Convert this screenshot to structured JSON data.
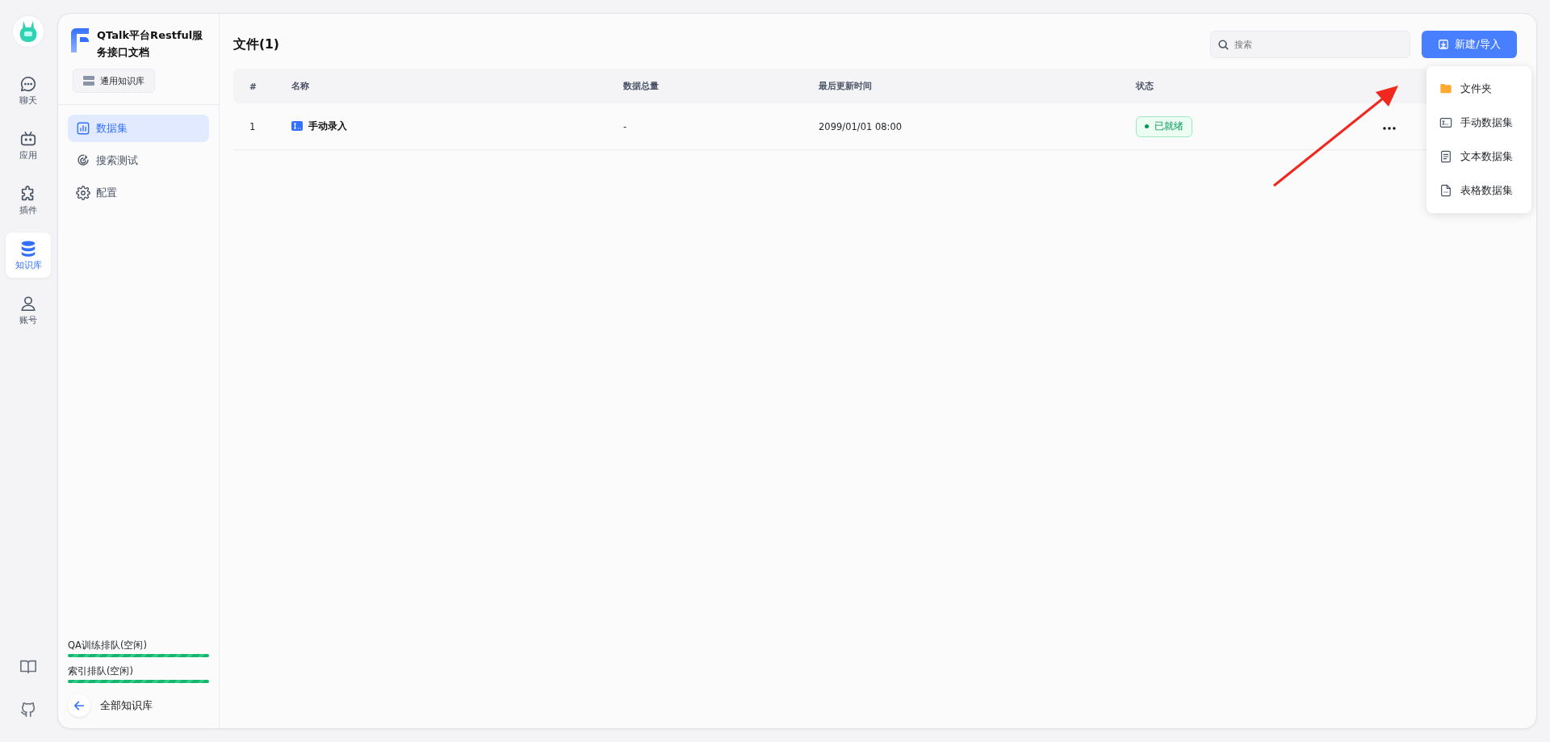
{
  "nav": {
    "items": [
      {
        "label": "聊天",
        "selected": false
      },
      {
        "label": "应用",
        "selected": false
      },
      {
        "label": "插件",
        "selected": false
      },
      {
        "label": "知识库",
        "selected": true
      },
      {
        "label": "账号",
        "selected": false
      }
    ]
  },
  "sidebar": {
    "title": "QTalk平台Restful服务接口文档",
    "type_button": "通用知识库",
    "menu": [
      {
        "label": "数据集",
        "selected": true
      },
      {
        "label": "搜索测试",
        "selected": false
      },
      {
        "label": "配置",
        "selected": false
      }
    ],
    "queues": [
      {
        "label": "QA训练排队(空闲)",
        "level": 1
      },
      {
        "label": "索引排队(空闲)",
        "level": 1
      }
    ],
    "back": "全部知识库"
  },
  "content": {
    "title": "文件(1)",
    "search": {
      "placeholder": "搜索"
    },
    "new_button": "新建/导入",
    "table": {
      "columns": [
        "#",
        "名称",
        "数据总量",
        "最后更新时间",
        "状态"
      ],
      "rows": [
        {
          "index": "1",
          "name": "手动录入",
          "count": "-",
          "updated": "2099/01/01 08:00",
          "status": "已就绪"
        }
      ]
    },
    "menu": [
      "文件夹",
      "手动数据集",
      "文本数据集",
      "表格数据集"
    ]
  }
}
